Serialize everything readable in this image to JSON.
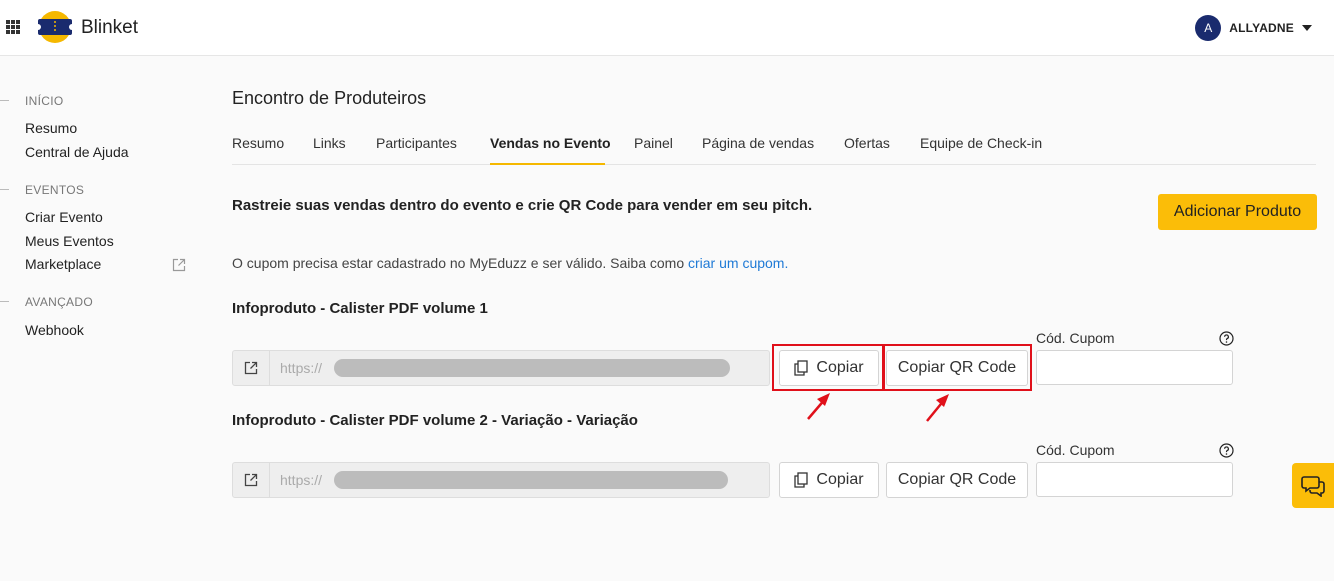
{
  "app": {
    "brand": "Blinket"
  },
  "user": {
    "avatar_initial": "A",
    "name": "ALLYADNE"
  },
  "sidebar": {
    "sections": [
      {
        "title": "INÍCIO",
        "items": [
          "Resumo",
          "Central de Ajuda"
        ]
      },
      {
        "title": "EVENTOS",
        "items": [
          "Criar Evento",
          "Meus Eventos",
          "Marketplace"
        ]
      },
      {
        "title": "AVANÇADO",
        "items": [
          "Webhook"
        ]
      }
    ]
  },
  "page": {
    "title": "Encontro de Produteiros",
    "tabs": [
      "Resumo",
      "Links",
      "Participantes",
      "Vendas no Evento",
      "Painel",
      "Página de vendas",
      "Ofertas",
      "Equipe de Check-in"
    ],
    "active_tab": "Vendas no Evento",
    "headline": "Rastreie suas vendas dentro do evento e crie QR Code para vender em seu pitch.",
    "add_product_label": "Adicionar Produto",
    "info_text": "O cupom precisa estar cadastrado no MyEduzz e ser válido. Saiba como ",
    "info_link": "criar um cupom."
  },
  "products": [
    {
      "title": "Infoproduto - Calister PDF volume 1",
      "link_prefix": "https://",
      "copy_label": "Copiar",
      "qr_label": "Copiar QR Code",
      "coupon_label": "Cód. Cupom",
      "coupon_value": ""
    },
    {
      "title": "Infoproduto - Calister PDF volume 2 - Variação - Variação",
      "link_prefix": "https://",
      "copy_label": "Copiar",
      "qr_label": "Copiar QR Code",
      "coupon_label": "Cód. Cupom",
      "coupon_value": ""
    }
  ],
  "colors": {
    "accent": "#fbbd08",
    "link": "#1f7ad6",
    "highlight": "#e0101a",
    "avatar": "#1a2b6e"
  },
  "icons": [
    "apps-grid-icon",
    "blinket-logo-icon",
    "chevron-down-icon",
    "external-link-icon",
    "open-link-icon",
    "copy-icon",
    "help-icon",
    "chat-icon",
    "red-arrow-icon"
  ]
}
